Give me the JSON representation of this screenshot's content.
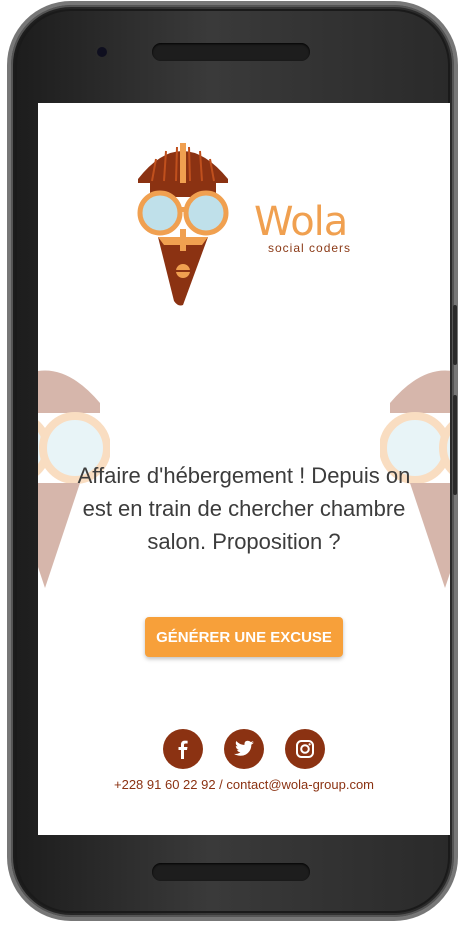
{
  "brand": {
    "name": "Wola",
    "tagline": "social coders"
  },
  "excuse": {
    "text": "Affaire d'hébergement ! Depuis on est en train de chercher chambre salon. Proposition ?"
  },
  "cta": {
    "label": "GÉNÉRER UNE EXCUSE"
  },
  "socials": [
    {
      "icon": "facebook-icon"
    },
    {
      "icon": "twitter-icon"
    },
    {
      "icon": "instagram-icon"
    }
  ],
  "contact": {
    "text": "+228 91 60 22 92 / contact@wola-group.com"
  },
  "colors": {
    "accent": "#f7a03a",
    "brand_brown": "#8b3212",
    "brand_orange": "#f0a050",
    "text": "#3c3c3c"
  }
}
